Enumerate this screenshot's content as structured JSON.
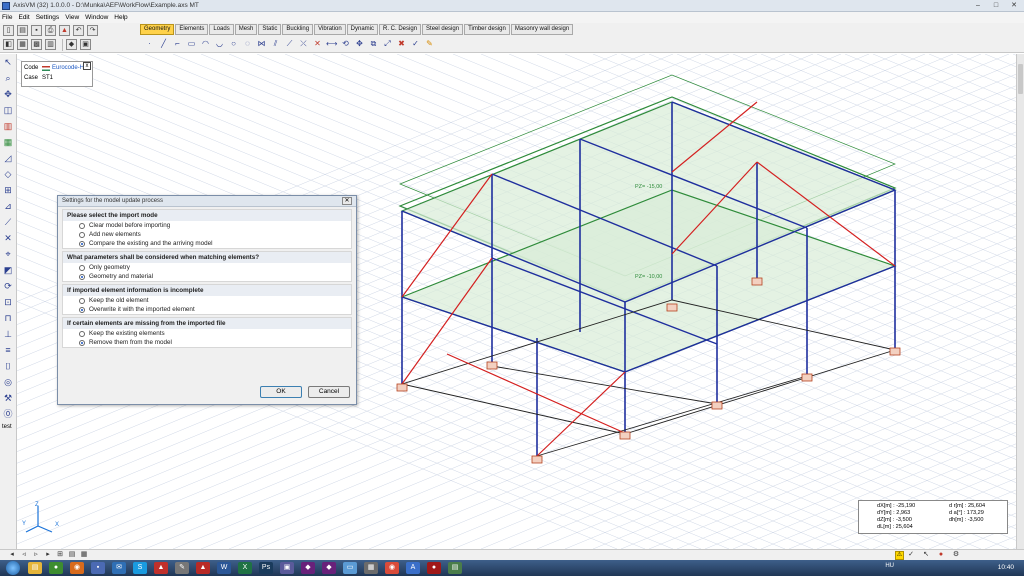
{
  "window": {
    "title": "AxisVM (32) 1.0.0.0 - D:\\Munka\\AEF\\WorkFlow\\Example.axs MT",
    "minimize": "–",
    "maximize": "□",
    "close": "✕"
  },
  "menu": [
    "File",
    "Edit",
    "Settings",
    "View",
    "Window",
    "Help"
  ],
  "tabs": [
    "Geometry",
    "Elements",
    "Loads",
    "Mesh",
    "Static",
    "Buckling",
    "Vibration",
    "Dynamic",
    "R. C. Design",
    "Steel design",
    "Timber design",
    "Masonry wall design"
  ],
  "active_tab": "Geometry",
  "left_toolbar": {
    "bottom_label": "test"
  },
  "code_panel": {
    "code_label": "Code",
    "code_value": "Eurocode-H",
    "case_label": "Case",
    "case_value": "ST1",
    "close": "x"
  },
  "dialog": {
    "title": "Settings for the model update process",
    "close": "✕",
    "sections": [
      {
        "heading": "Please select the import mode",
        "options": [
          "Clear model before importing",
          "Add new elements",
          "Compare the existing and the arriving model"
        ],
        "selected": 2
      },
      {
        "heading": "What parameters shall be considered when matching elements?",
        "options": [
          "Only geometry",
          "Geometry and material"
        ],
        "selected": 1
      },
      {
        "heading": "If imported element information is incomplete",
        "options": [
          "Keep the old element",
          "Overwrite it with the imported element"
        ],
        "selected": 1
      },
      {
        "heading": "If certain elements are missing from the imported file",
        "options": [
          "Keep the existing elements",
          "Remove them from the model"
        ],
        "selected": 1
      }
    ],
    "ok": "OK",
    "cancel": "Cancel"
  },
  "model_labels": {
    "slab_top": "PZ= -15,00",
    "slab_mid": "PZ= -10,00"
  },
  "axes": {
    "z": "Z",
    "y": "Y",
    "x": "X"
  },
  "coord_info": {
    "left": [
      "dX[m] : -25,190",
      "dY[m] : 2,963",
      "dZ[m] : -3,500",
      "dL[m] : 25,604"
    ],
    "right": [
      "d r[m] : 25,604",
      "d a[°] : 173,29",
      "dh[m] : -3,500"
    ]
  },
  "taskbar": {
    "lang": "HU",
    "time": "10:40"
  },
  "colors": {
    "frame_blue": "#1f2f9e",
    "brace_red": "#d42020",
    "slab_green": "#2e8b3a",
    "grid": "#cfd7e6",
    "active_tab": "#ffd24a"
  }
}
